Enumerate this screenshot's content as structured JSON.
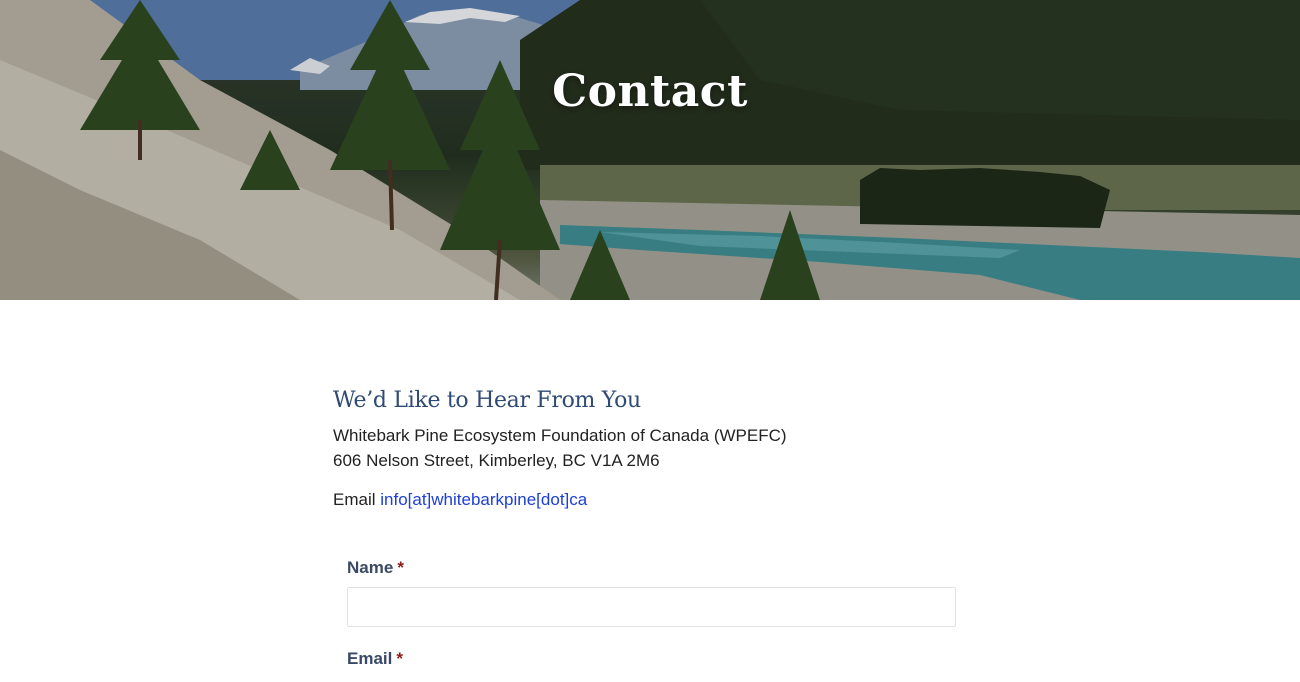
{
  "hero": {
    "title": "Contact"
  },
  "section": {
    "heading": "We’d Like to Hear From You",
    "org_name": "Whitebark Pine Ecosystem Foundation of Canada (WPEFC)",
    "address": "606 Nelson Street, Kimberley, BC V1A 2M6",
    "email_label": "Email",
    "email_link": "info[at]whitebarkpine[dot]ca"
  },
  "form": {
    "name_label": "Name",
    "name_value": "",
    "email_label": "Email",
    "required_marker": "*"
  },
  "colors": {
    "heading": "#2f4a74",
    "link": "#1c3fd8",
    "required": "#8b1a1a",
    "label": "#3a4a66"
  }
}
